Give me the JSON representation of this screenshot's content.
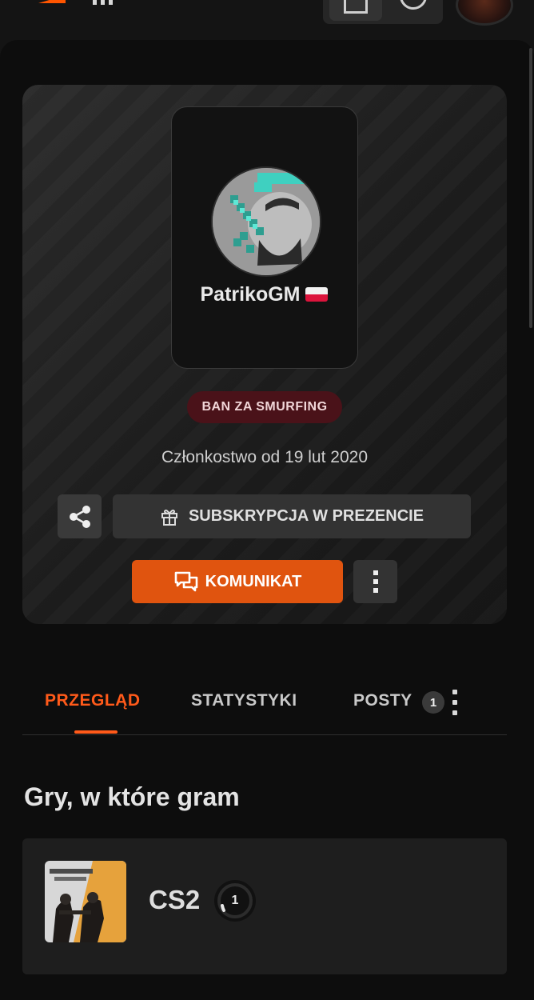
{
  "profile": {
    "username": "PatrikoGM",
    "country_flag": "poland-flag",
    "badge": "BAN ZA SMURFING",
    "member_since": "Członkostwo od 19 lut 2020"
  },
  "actions": {
    "share_icon": "share-icon",
    "gift_label": "SUBSKRYPCJA W PREZENCIE",
    "message_label": "KOMUNIKAT"
  },
  "tabs": [
    {
      "label": "PRZEGLĄD",
      "active": true
    },
    {
      "label": "STATYSTYKI",
      "active": false
    },
    {
      "label": "POSTY",
      "active": false,
      "count": "1"
    }
  ],
  "games_section": {
    "title": "Gry, w które gram",
    "games": [
      {
        "name": "CS2",
        "level": "1"
      }
    ]
  },
  "colors": {
    "accent": "#ff5500",
    "badge_bg": "#4a1219",
    "button_dark": "#333333"
  }
}
